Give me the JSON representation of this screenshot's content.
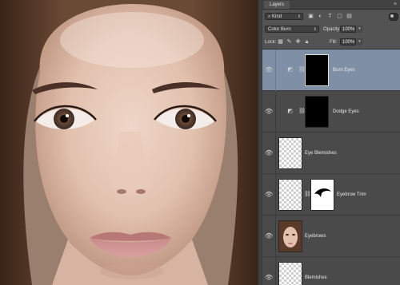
{
  "panel": {
    "tab_label": "Layers",
    "menu_icon": "panel-menu-icon",
    "filter": {
      "value": "Kind",
      "icons": [
        "image-filter-icon",
        "adjustment-filter-icon",
        "type-filter-icon",
        "shape-filter-icon",
        "smart-object-filter-icon"
      ]
    },
    "blend_mode": "Color Burn",
    "opacity_label": "Opacity:",
    "opacity_value": "100%",
    "lock_label": "Lock:",
    "lock_icons": [
      "lock-transparent-icon",
      "lock-image-icon",
      "lock-position-icon",
      "lock-all-icon"
    ],
    "fill_label": "Fill:",
    "fill_value": "100%"
  },
  "layers": [
    {
      "name": "Burn Eyes",
      "selected": true,
      "adjustment": true,
      "thumb": "black",
      "linked": true
    },
    {
      "name": "Dodge Eyes",
      "selected": false,
      "adjustment": true,
      "thumb": "black",
      "linked": true
    },
    {
      "name": "Eye Blemishes",
      "selected": false,
      "adjustment": false,
      "thumb": "checker"
    },
    {
      "name": "Eyebrow Trim",
      "selected": false,
      "adjustment": false,
      "thumb": "checker",
      "linked": true
    },
    {
      "name": "Eyebrows",
      "selected": false,
      "adjustment": false,
      "thumb": "photo"
    },
    {
      "name": "Blemishes",
      "selected": false,
      "adjustment": false,
      "thumb": "checker"
    }
  ],
  "colors": {
    "selected_row": "#7f8fa5",
    "panel_bg": "#535353",
    "row_bg": "#4a4a4a"
  }
}
